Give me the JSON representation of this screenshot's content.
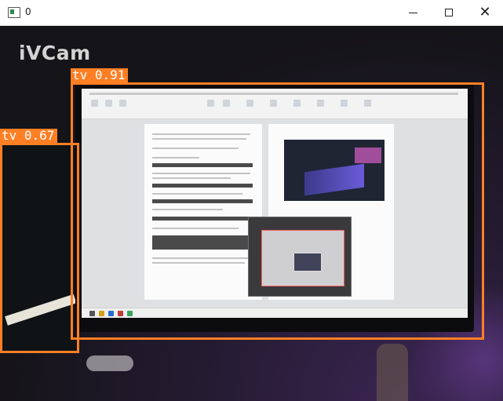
{
  "window": {
    "title": "0",
    "minimize_symbol": "",
    "maximize_symbol": "",
    "close_symbol": "✕"
  },
  "camera": {
    "watermark": "iVCam"
  },
  "detections": [
    {
      "label": "tv",
      "score": "0.91",
      "text": "tv 0.91"
    },
    {
      "label": "tv",
      "score": "0.67",
      "text": "tv 0.67"
    }
  ],
  "colors": {
    "detection_box": "#ff7f24",
    "label_text": "#ffffff",
    "titlebar_bg": "#ffffff"
  },
  "icons": [
    "app-icon",
    "minimize-icon",
    "maximize-icon",
    "close-icon"
  ]
}
